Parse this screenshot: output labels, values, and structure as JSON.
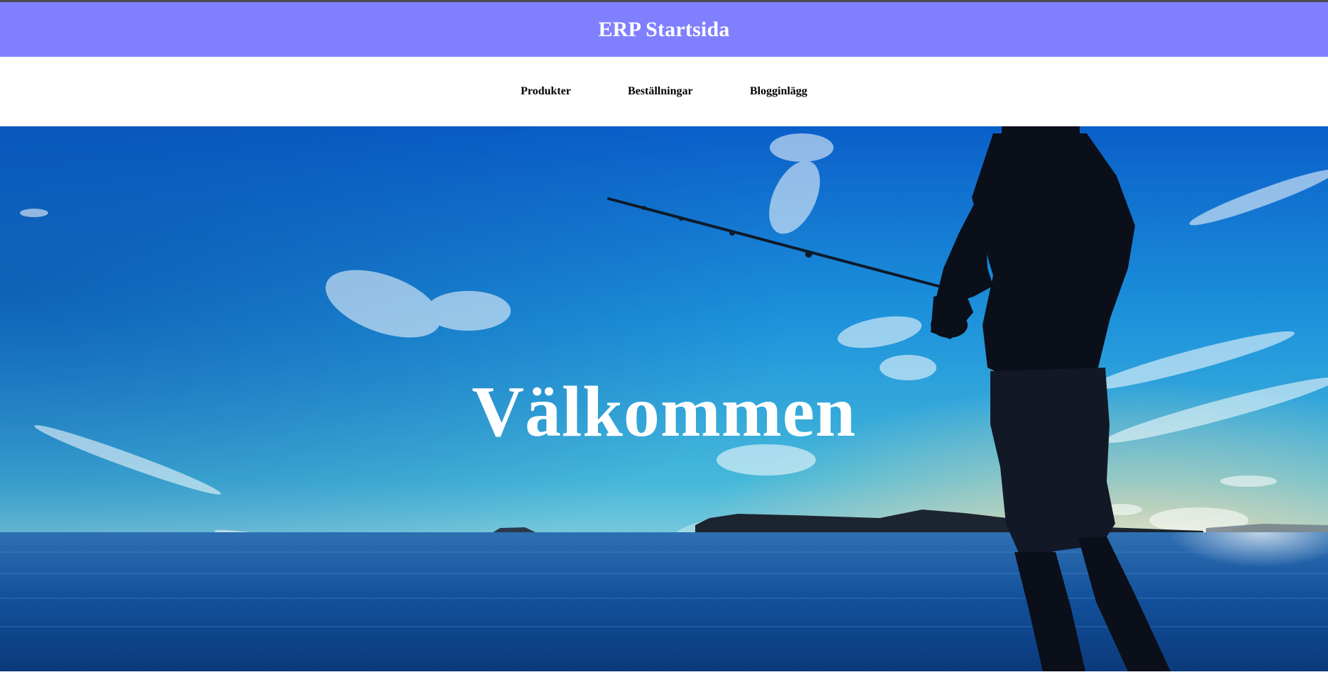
{
  "header": {
    "title": "ERP Startsida",
    "background_color": "#8080ff"
  },
  "nav": {
    "items": [
      {
        "label": "Produkter"
      },
      {
        "label": "Beställningar"
      },
      {
        "label": "Blogginlägg"
      }
    ]
  },
  "hero": {
    "title": "Välkommen",
    "image_subject": "silhouette of a man fishing at the sea against a blue sky at sunset"
  }
}
